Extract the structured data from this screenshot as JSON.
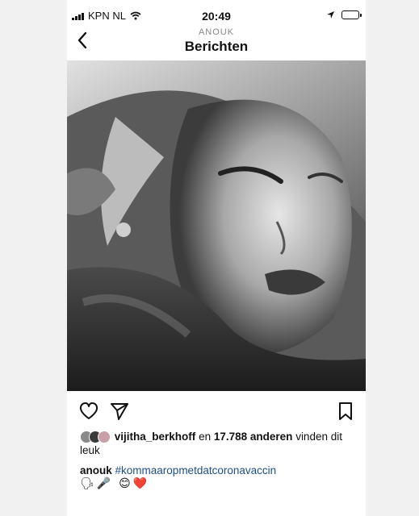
{
  "status_bar": {
    "carrier": "KPN NL",
    "time": "20:49",
    "icons": [
      "signal-bars-icon",
      "wifi-icon",
      "location-arrow-icon",
      "battery-icon"
    ]
  },
  "header": {
    "subtitle": "ANOUK",
    "title": "Berichten",
    "back_icon": "chevron-left-icon"
  },
  "post": {
    "image_icon": "photo",
    "actions": [
      "heart-icon",
      "send-icon",
      "bookmark-icon"
    ],
    "likes": {
      "user": "vijitha_berkhoff",
      "connector": "en",
      "count_text": "17.788 anderen",
      "suffix": "vinden dit leuk"
    },
    "caption": {
      "username": "anouk",
      "hashtag": "#kommaaropmetdatcoronavaccin",
      "emojis": "🗣🎤 😊❤️"
    }
  },
  "colors": {
    "background": "#f1f1f1",
    "card": "#ffffff",
    "hashtag": "#1e4f8a"
  }
}
